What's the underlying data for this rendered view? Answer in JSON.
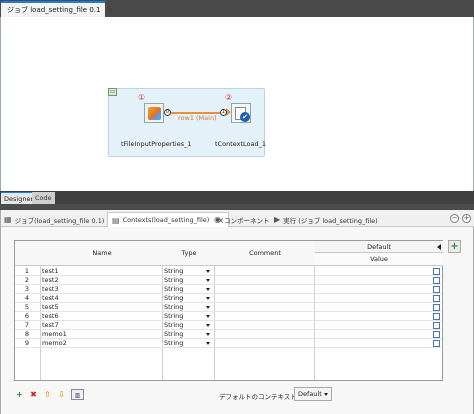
{
  "editor": {
    "tab_title": "ジョブ load_setting_file 0.1",
    "close": "×"
  },
  "canvas": {
    "components": [
      {
        "label": "tFileInputProperties_1",
        "badge": "①"
      },
      {
        "label": "tContextLoad_1",
        "badge": "②"
      }
    ],
    "connection_label": "row1 (Main)",
    "port_out": "0",
    "port_in": "1"
  },
  "mode_tabs": {
    "designer": "Designer",
    "code": "Code"
  },
  "panel": {
    "tabs": [
      {
        "label": "ジョブ(load_setting_file 0.1)"
      },
      {
        "label": "Contexts(load_setting_file)"
      },
      {
        "label": "コンポーネント"
      },
      {
        "label": "実行 (ジョブ load_setting_file)"
      }
    ],
    "close": "×",
    "minimize": "−",
    "maximize": "+"
  },
  "table": {
    "headers": {
      "name": "Name",
      "type": "Type",
      "comment": "Comment",
      "default": "Default",
      "value": "Value"
    },
    "rows": [
      {
        "num": "1",
        "name": "test1",
        "type": "String"
      },
      {
        "num": "2",
        "name": "test2",
        "type": "String"
      },
      {
        "num": "3",
        "name": "test3",
        "type": "String"
      },
      {
        "num": "4",
        "name": "test4",
        "type": "String"
      },
      {
        "num": "5",
        "name": "test5",
        "type": "String"
      },
      {
        "num": "6",
        "name": "test6",
        "type": "String"
      },
      {
        "num": "7",
        "name": "test7",
        "type": "String"
      },
      {
        "num": "8",
        "name": "memo1",
        "type": "String"
      },
      {
        "num": "9",
        "name": "memo2",
        "type": "String"
      }
    ]
  },
  "toolbar": {
    "add": "+",
    "remove": "✖",
    "up": "⇧",
    "down": "⇩",
    "default_env_label": "デフォルトのコンテキスト環境",
    "default_env_value": "Default"
  },
  "colors": {
    "accent": "#1f7fd6",
    "connection": "#e8913a",
    "badge": "#d23030"
  }
}
